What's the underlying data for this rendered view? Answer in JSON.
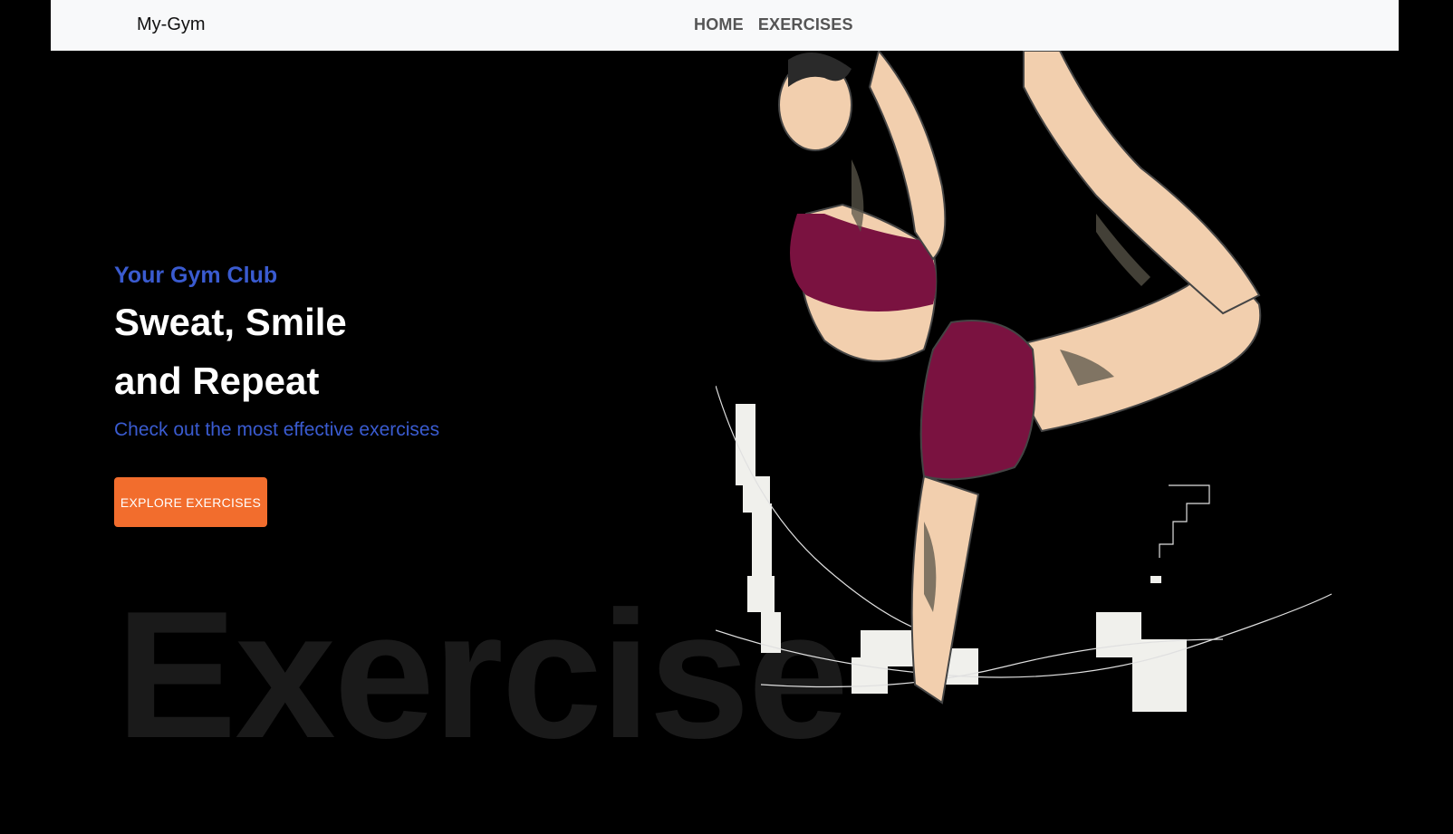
{
  "navbar": {
    "brand": "My-Gym",
    "links": [
      "HOME",
      "EXERCISES"
    ]
  },
  "hero": {
    "eyebrow": "Your Gym Club",
    "headline_line1": "Sweat, Smile",
    "headline_line2": "and Repeat",
    "subtext": "Check out the most effective exercises",
    "cta_label": "EXPLORE EXERCISES",
    "watermark": "Exercise"
  },
  "colors": {
    "accent_blue": "#3a5bd0",
    "cta_orange": "#f26d2d",
    "background": "#000000",
    "navbar_bg": "#f8f9fa"
  }
}
